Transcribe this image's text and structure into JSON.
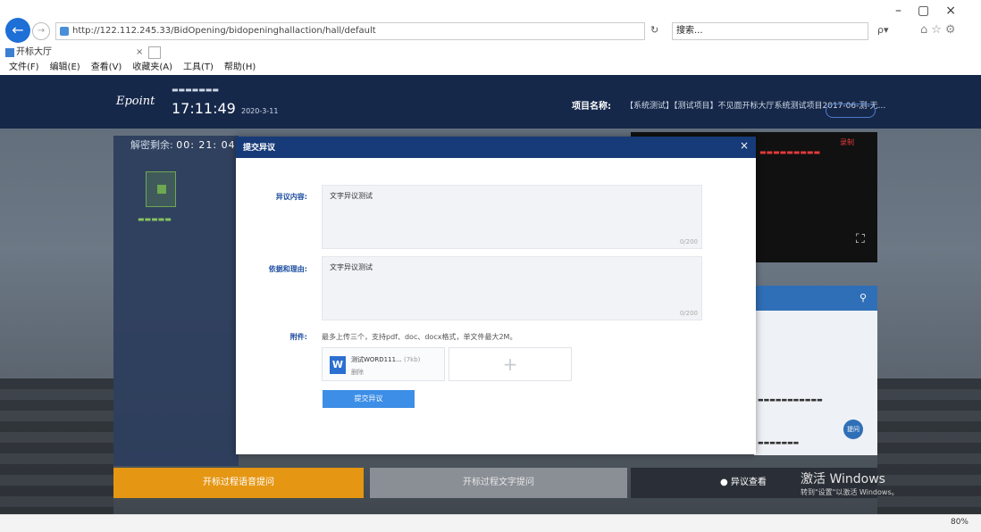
{
  "browser": {
    "url": "http://122.112.245.33/BidOpening/bidopeninghallaction/hall/default",
    "search_placeholder": "搜索...",
    "tab_title": "开标大厅",
    "tab_close": "×",
    "menu": [
      "文件(F)",
      "编辑(E)",
      "查看(V)",
      "收藏夹(A)",
      "工具(T)",
      "帮助(H)"
    ],
    "zoom": "80%",
    "back_glyph": "←",
    "forward_glyph": "→",
    "refresh_glyph": "↻",
    "search_glyph": "ρ▾",
    "fav_glyphs": "⌂☆⚙",
    "window_controls": "–▢×"
  },
  "header": {
    "logo": "Epoint",
    "clock": "17:11:49",
    "clock_date": "2020-3-11",
    "project_label": "项目名称:",
    "project_name": "【系统测试】【测试项目】不见面开标大厅系统测试项目2017-06-测-无..."
  },
  "left_panel": {
    "countdown_label": "解密剩余:",
    "countdown_value": "00: 21: 04"
  },
  "video": {
    "badge": "录制",
    "fullscreen_glyph": "⛶"
  },
  "chat": {
    "search_glyph": "⚲",
    "fab": "提问"
  },
  "footer": {
    "btn_orange": "开标过程语音提问",
    "btn_gray": "开标过程文字提问",
    "btn_dark": "● 异议查看",
    "watermark": "激活 Windows",
    "watermark_sub": "转到\"设置\"以激活 Windows。"
  },
  "modal": {
    "title": "提交异议",
    "close": "×",
    "field1_label": "异议内容:",
    "field1_value": "文字异议测试",
    "field1_count": "0/200",
    "field2_label": "依据和理由:",
    "field2_value": "文字异议测试",
    "field2_count": "0/200",
    "attach_label": "附件:",
    "attach_hint": "最多上传三个，支持pdf、doc、docx格式，单文件最大2M。",
    "file_icon": "W",
    "file_name": "测试WORD111...",
    "file_size": "(7kb)",
    "file_delete": "删除",
    "upload_plus": "+",
    "submit": "提交异议"
  }
}
